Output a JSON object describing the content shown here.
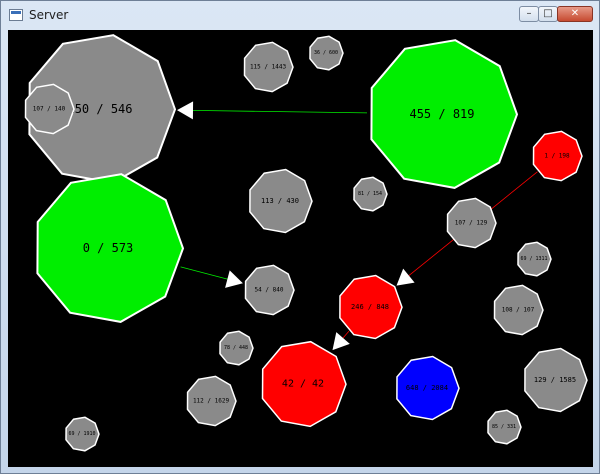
{
  "window": {
    "title": "Server",
    "buttons": {
      "minimize": "–",
      "maximize": "□",
      "close": "✕"
    }
  },
  "colors": {
    "background": "#000000",
    "neutral": "#8a8a8a",
    "green": "#00ee00",
    "red": "#ff0000",
    "blue": "#0000ff",
    "outline": "#ffffff"
  },
  "nodes": [
    {
      "id": "n1",
      "label": "150 / 546",
      "color": "neutral",
      "size": "huge"
    },
    {
      "id": "n2",
      "label": "107 / 140",
      "color": "neutral",
      "size": "small"
    },
    {
      "id": "n3",
      "label": "115 / 1443",
      "color": "neutral",
      "size": "small"
    },
    {
      "id": "n4",
      "label": "36 / 600",
      "color": "neutral",
      "size": "tiny"
    },
    {
      "id": "n5",
      "label": "455 / 819",
      "color": "green",
      "size": "huge"
    },
    {
      "id": "n6",
      "label": "1 / 198",
      "color": "red",
      "size": "small"
    },
    {
      "id": "n7",
      "label": "0 / 573",
      "color": "green",
      "size": "huge"
    },
    {
      "id": "n8",
      "label": "113 / 430",
      "color": "neutral",
      "size": "medium"
    },
    {
      "id": "n9",
      "label": "81 / 154",
      "color": "neutral",
      "size": "tiny"
    },
    {
      "id": "n10",
      "label": "107 / 129",
      "color": "neutral",
      "size": "small"
    },
    {
      "id": "n11",
      "label": "69 / 1311",
      "color": "neutral",
      "size": "tiny"
    },
    {
      "id": "n12",
      "label": "54 / 840",
      "color": "neutral",
      "size": "small"
    },
    {
      "id": "n13",
      "label": "246 / 848",
      "color": "red",
      "size": "medium"
    },
    {
      "id": "n14",
      "label": "108 / 107",
      "color": "neutral",
      "size": "small"
    },
    {
      "id": "n15",
      "label": "78 / 448",
      "color": "neutral",
      "size": "tiny"
    },
    {
      "id": "n16",
      "label": "42 / 42",
      "color": "red",
      "size": "large"
    },
    {
      "id": "n17",
      "label": "648 / 2084",
      "color": "blue",
      "size": "medium"
    },
    {
      "id": "n18",
      "label": "129 / 1585",
      "color": "neutral",
      "size": "medium"
    },
    {
      "id": "n19",
      "label": "112 / 1629",
      "color": "neutral",
      "size": "small"
    },
    {
      "id": "n20",
      "label": "69 / 1910",
      "color": "neutral",
      "size": "tiny"
    },
    {
      "id": "n21",
      "label": "85 / 331",
      "color": "neutral",
      "size": "tiny"
    }
  ],
  "links": [
    {
      "from": "n5",
      "to": "n1",
      "color": "green"
    },
    {
      "from": "n7",
      "to": "n12",
      "color": "green"
    },
    {
      "from": "n7",
      "to": "n1",
      "color": "green"
    },
    {
      "from": "n6",
      "to": "n13",
      "color": "red"
    },
    {
      "from": "n13",
      "to": "n16",
      "color": "red"
    }
  ]
}
